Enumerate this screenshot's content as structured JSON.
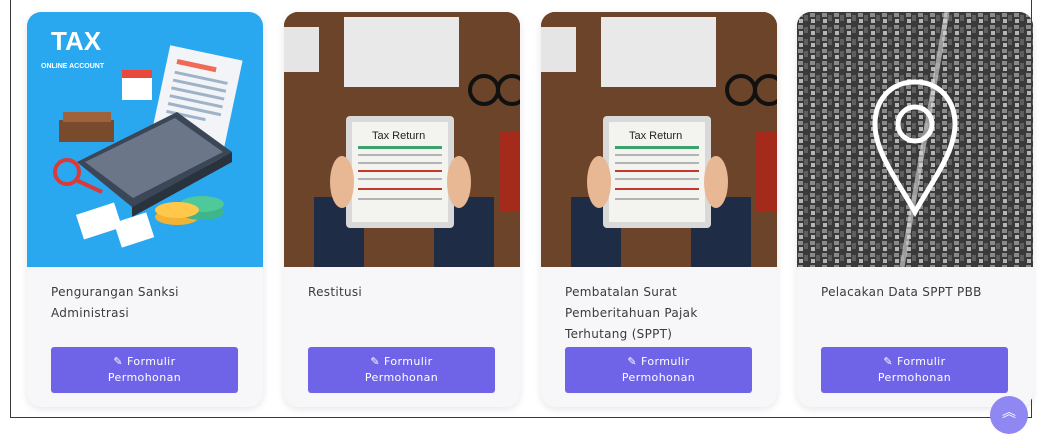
{
  "cards": [
    {
      "title_lines": [
        "Pengurangan Sanksi",
        "Administrasi"
      ],
      "image": {
        "type": "illustration",
        "headline": "TAX",
        "subline": "ONLINE ACCOUNT",
        "background": "#29a8f0"
      },
      "button": {
        "line1": "Formulir",
        "line2": "Permohonan"
      }
    },
    {
      "title_lines": [
        "Restitusi"
      ],
      "image": {
        "type": "photo",
        "form_title": "Tax Return",
        "background": "#5c3a26"
      },
      "button": {
        "line1": "Formulir",
        "line2": "Permohonan"
      }
    },
    {
      "title_lines": [
        "Pembatalan Surat",
        "Pemberitahuan Pajak",
        "Terhutang (SPPT)"
      ],
      "image": {
        "type": "photo",
        "form_title": "Tax Return",
        "background": "#5c3a26"
      },
      "button": {
        "line1": "Formulir",
        "line2": "Permohonan"
      }
    },
    {
      "title_lines": [
        "Pelacakan Data SPPT PBB"
      ],
      "image": {
        "type": "photo-map",
        "background": "#2e2e2e"
      },
      "button": {
        "line1": "Formulir",
        "line2": "Permohonan"
      }
    }
  ],
  "icons": {
    "button_icon": "pencil-icon",
    "scroll_top": "chevron-double-up-icon"
  },
  "colors": {
    "button": "#6f63e8",
    "scroll_top": "#8f88f2",
    "card_bg": "#f7f7f9"
  }
}
